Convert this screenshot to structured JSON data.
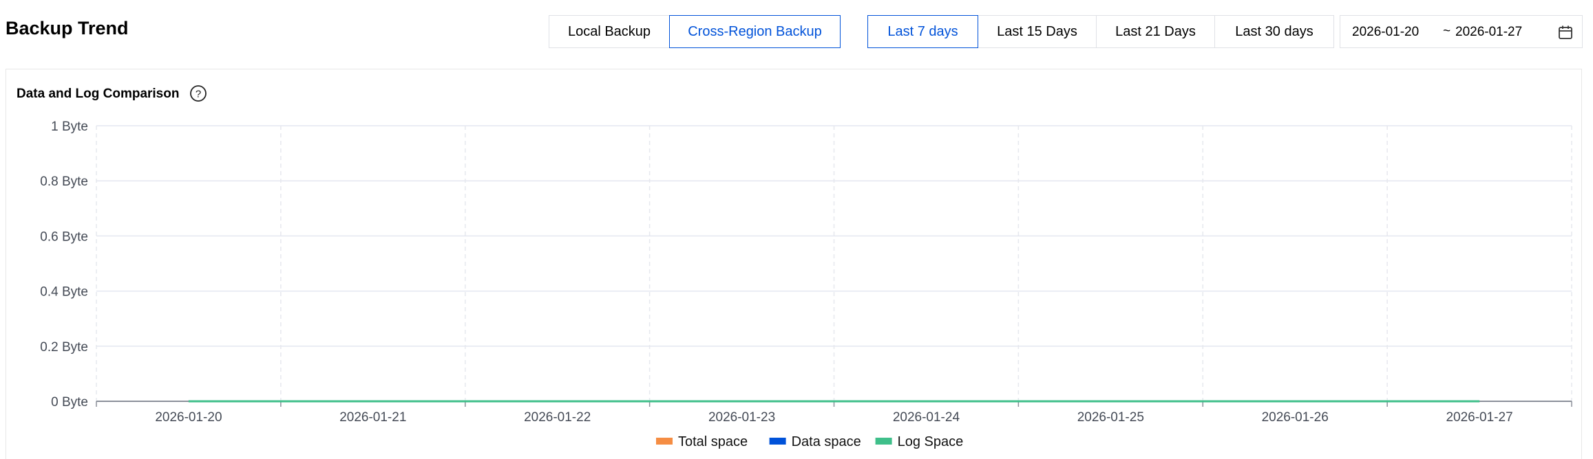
{
  "page": {
    "title": "Backup Trend"
  },
  "backup_type": {
    "options": [
      "Local Backup",
      "Cross-Region Backup"
    ],
    "selected": "Cross-Region Backup"
  },
  "time_range": {
    "options": [
      "Last 7 days",
      "Last 15 Days",
      "Last 21 Days",
      "Last 30 days"
    ],
    "selected": "Last 7 days"
  },
  "date_picker": {
    "start": "2026-01-20",
    "separator": "~",
    "end": "2026-01-27",
    "icon": "calendar-icon"
  },
  "panel": {
    "title": "Data and Log Comparison",
    "help_icon": "question-circle-icon"
  },
  "colors": {
    "accent": "#0052d9",
    "total_space": "#f58d43",
    "data_space": "#0052d9",
    "log_space": "#3fbf8a"
  },
  "chart_data": {
    "type": "line",
    "title": "Data and Log Comparison",
    "x": [
      "2026-01-20",
      "2026-01-21",
      "2026-01-22",
      "2026-01-23",
      "2026-01-24",
      "2026-01-25",
      "2026-01-26",
      "2026-01-27"
    ],
    "y_ticks": [
      "0 Byte",
      "0.2 Byte",
      "0.4 Byte",
      "0.6 Byte",
      "0.8 Byte",
      "1 Byte"
    ],
    "ylim": [
      0,
      1
    ],
    "grid": true,
    "legend_position": "bottom-center",
    "series": [
      {
        "name": "Total space",
        "color": "#f58d43",
        "values": [
          0,
          0,
          0,
          0,
          0,
          0,
          0,
          0
        ]
      },
      {
        "name": "Data space",
        "color": "#0052d9",
        "values": [
          0,
          0,
          0,
          0,
          0,
          0,
          0,
          0
        ]
      },
      {
        "name": "Log Space",
        "color": "#3fbf8a",
        "values": [
          0,
          0,
          0,
          0,
          0,
          0,
          0,
          0
        ]
      }
    ]
  }
}
